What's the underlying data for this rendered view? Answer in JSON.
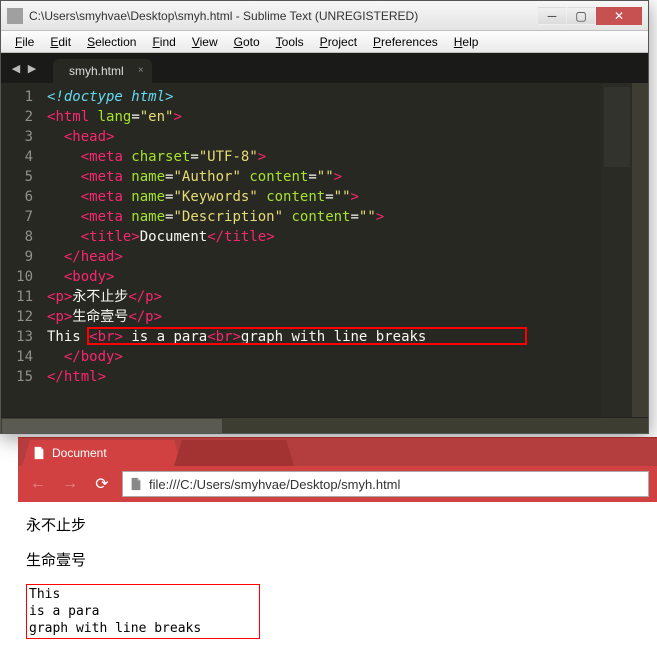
{
  "sublime": {
    "title": "C:\\Users\\smyhvae\\Desktop\\smyh.html - Sublime Text (UNREGISTERED)",
    "menus": [
      "File",
      "Edit",
      "Selection",
      "Find",
      "View",
      "Goto",
      "Tools",
      "Project",
      "Preferences",
      "Help"
    ],
    "tab": "smyh.html",
    "lines": [
      "1",
      "2",
      "3",
      "4",
      "5",
      "6",
      "7",
      "8",
      "9",
      "10",
      "11",
      "12",
      "13",
      "14",
      "15"
    ],
    "code": {
      "l1": "<!doctype html>",
      "l2a": "<",
      "l2b": "html",
      "l2c": " lang",
      "l2d": "=",
      "l2e": "\"en\"",
      "l2f": ">",
      "l3a": "  <",
      "l3b": "head",
      "l3c": ">",
      "l4a": "    <",
      "l4b": "meta",
      "l4c": " charset",
      "l4d": "=",
      "l4e": "\"UTF-8\"",
      "l4f": ">",
      "l5a": "    <",
      "l5b": "meta",
      "l5c": " name",
      "l5d": "=",
      "l5e": "\"Author\"",
      "l5f": " content",
      "l5g": "=",
      "l5h": "\"\"",
      "l5i": ">",
      "l6a": "    <",
      "l6b": "meta",
      "l6c": " name",
      "l6d": "=",
      "l6e": "\"Keywords\"",
      "l6f": " content",
      "l6g": "=",
      "l6h": "\"\"",
      "l6i": ">",
      "l7a": "    <",
      "l7b": "meta",
      "l7c": " name",
      "l7d": "=",
      "l7e": "\"Description\"",
      "l7f": " content",
      "l7g": "=",
      "l7h": "\"\"",
      "l7i": ">",
      "l8a": "    <",
      "l8b": "title",
      "l8c": ">",
      "l8d": "Document",
      "l8e": "</",
      "l8f": "title",
      "l8g": ">",
      "l9a": "  </",
      "l9b": "head",
      "l9c": ">",
      "l10a": "  <",
      "l10b": "body",
      "l10c": ">",
      "l11a": "<",
      "l11b": "p",
      "l11c": ">",
      "l11d": "永不止步",
      "l11e": "</",
      "l11f": "p",
      "l11g": ">",
      "l12a": "<",
      "l12b": "p",
      "l12c": ">",
      "l12d": "生命壹号",
      "l12e": "</",
      "l12f": "p",
      "l12g": ">",
      "l13a": "This ",
      "l13b": "<",
      "l13c": "br",
      "l13d": ">",
      "l13e": " is a para",
      "l13f": "<",
      "l13g": "br",
      "l13h": ">",
      "l13i": "graph with line breaks",
      "l14a": "  </",
      "l14b": "body",
      "l14c": ">",
      "l15a": "</",
      "l15b": "html",
      "l15c": ">"
    }
  },
  "chrome": {
    "tab_title": "Document",
    "url": "file:///C:/Users/smyhvae/Desktop/smyh.html",
    "page": {
      "p1": "永不止步",
      "p2": "生命壹号",
      "br1": "This",
      "br2": "is a para",
      "br3": "graph with line breaks"
    }
  }
}
